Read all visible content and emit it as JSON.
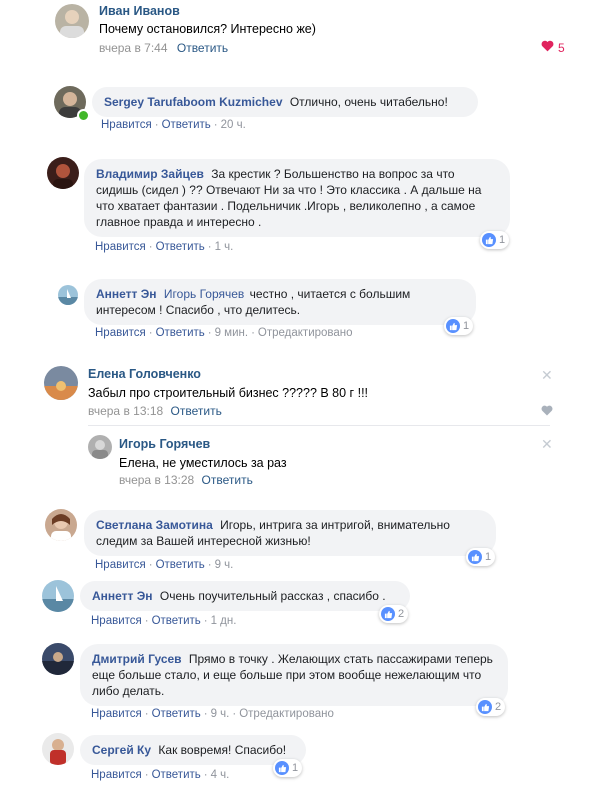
{
  "colors": {
    "fb_link": "#385898",
    "vk_link": "#2a5885",
    "like_blue": "#5890ff",
    "heart_red": "#e0245e",
    "online_green": "#42b72a"
  },
  "top_comment": {
    "author": "Иван Иванов",
    "text": "Почему остановился? Интересно же)",
    "time": "вчера в 7:44",
    "reply": "Ответить",
    "likes": "5",
    "like_icon": "heart-icon"
  },
  "fb_comments": [
    {
      "author": "Sergey Tarufaboom Kuzmichev",
      "text": "Отлично, очень читабельно!",
      "like": "Нравится",
      "reply": "Ответить",
      "time": "20 ч.",
      "edited": "",
      "likes": ""
    },
    {
      "author": "Владимир Зайцев",
      "text": "За крестик ? Большенство на вопрос за что сидишь (сидел ) ?? Отвечают Ни за что ! Это классика . А дальше на что хватает фантазии . Подельничик .Игорь , великолепно , а самое главное правда и интересно .",
      "like": "Нравится",
      "reply": "Ответить",
      "time": "1 ч.",
      "edited": "",
      "likes": "1"
    },
    {
      "author": "Аннетт Эн",
      "mention": "Игорь Горячев",
      "text": "честно , читается с большим интересом ! Спасибо , что делитесь.",
      "like": "Нравится",
      "reply": "Ответить",
      "time": "9 мин.",
      "edited": "Отредактировано",
      "likes": "1"
    }
  ],
  "vk_thread": {
    "author": "Елена Головченко",
    "text": "Забыл про строительный бизнес ????? В 80 г !!!",
    "time": "вчера в 13:18",
    "reply": "Ответить",
    "reply_item": {
      "author": "Игорь Горячев",
      "text": "Елена, не уместилось за раз",
      "time": "вчера в 13:28",
      "reply": "Ответить"
    }
  },
  "fb_comments_2": [
    {
      "author": "Светлана Замотина",
      "text": "Игорь, интрига за интригой, внимательно следим за Вашей интересной жизнью!",
      "like": "Нравится",
      "reply": "Ответить",
      "time": "9 ч.",
      "edited": "",
      "likes": "1"
    },
    {
      "author": "Аннетт Эн",
      "text": "Очень поучительный рассказ , спасибо .",
      "like": "Нравится",
      "reply": "Ответить",
      "time": "1 дн.",
      "edited": "",
      "likes": "2"
    },
    {
      "author": "Дмитрий Гусев",
      "text": "Прямо в точку . Желающих стать пассажирами теперь еще больше стало, и еще больше при этом вообще нежелающим что либо делать.",
      "like": "Нравится",
      "reply": "Ответить",
      "time": "9 ч.",
      "edited": "Отредактировано",
      "likes": "2"
    },
    {
      "author": "Сергей Ку",
      "text": "Как вовремя! Спасибо!",
      "like": "Нравится",
      "reply": "Ответить",
      "time": "4 ч.",
      "edited": "",
      "likes": "1"
    }
  ]
}
